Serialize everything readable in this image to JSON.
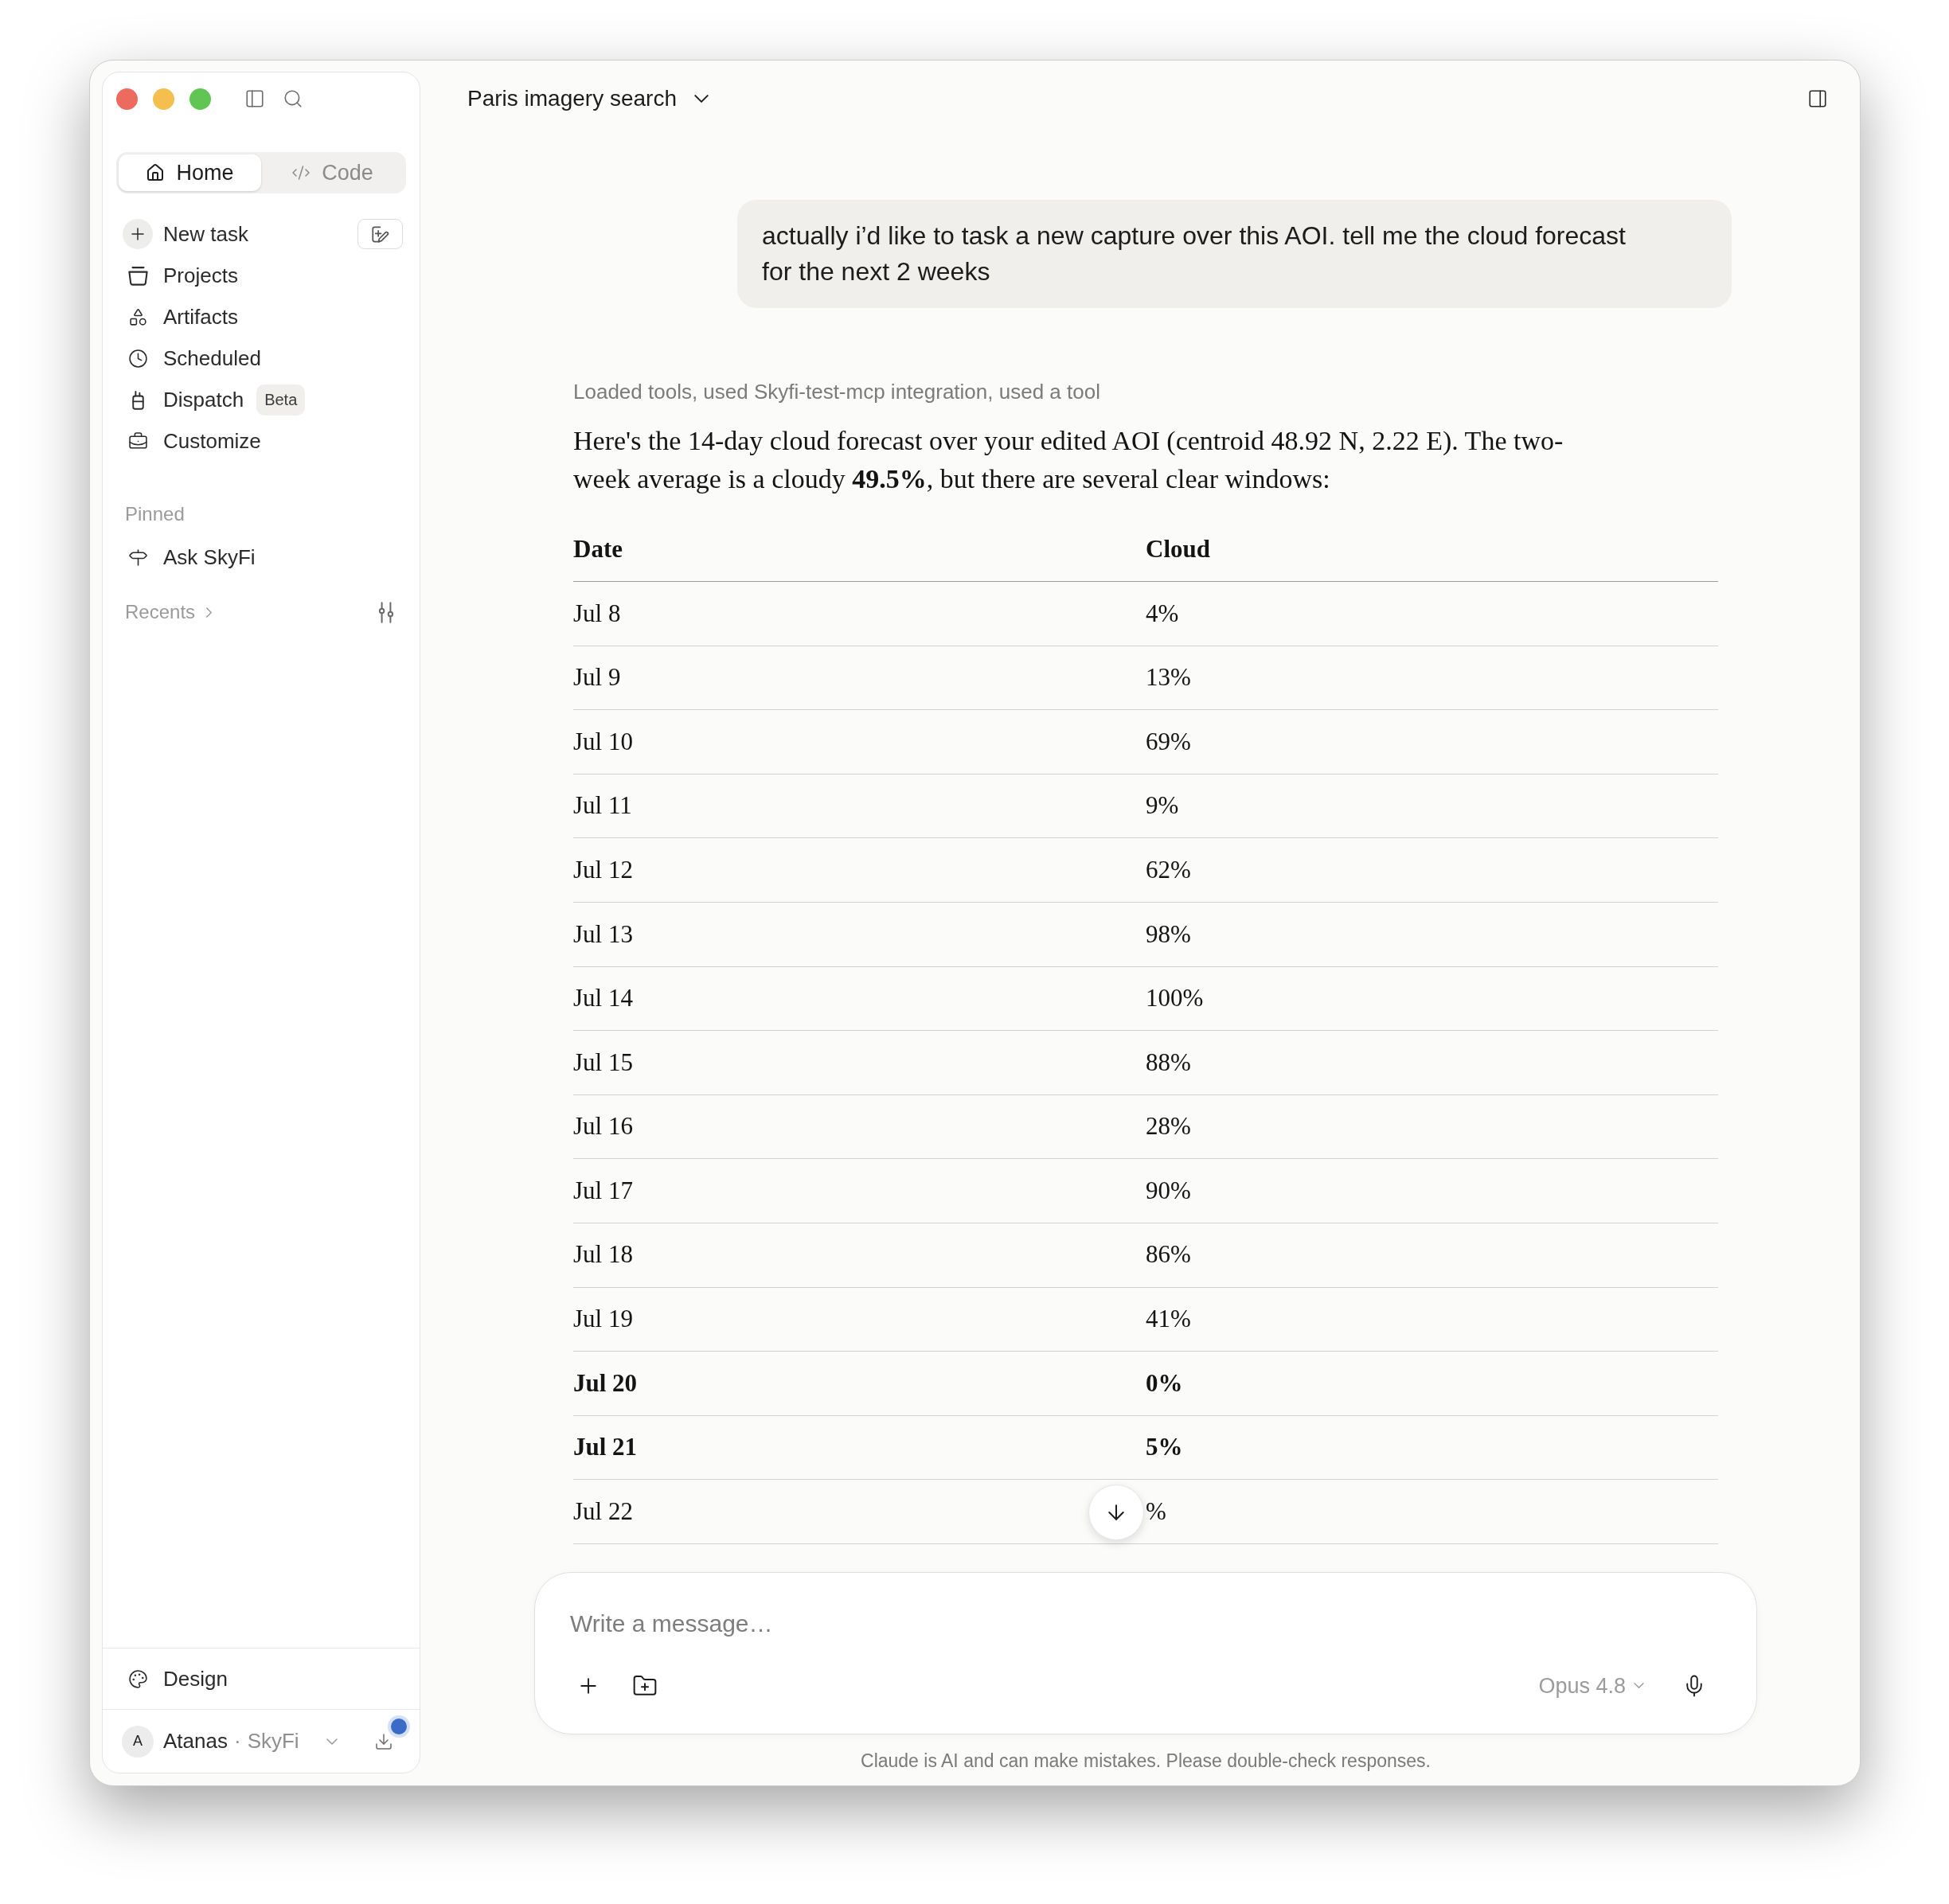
{
  "window": {
    "title": "Paris imagery search"
  },
  "sidebar": {
    "tabs": [
      {
        "label": "Home",
        "selected": true
      },
      {
        "label": "Code",
        "selected": false
      }
    ],
    "nav": [
      {
        "label": "New task",
        "kind": "action"
      },
      {
        "label": "Projects",
        "kind": "link"
      },
      {
        "label": "Artifacts",
        "kind": "link"
      },
      {
        "label": "Scheduled",
        "kind": "link"
      },
      {
        "label": "Dispatch",
        "kind": "link",
        "badge": "Beta"
      },
      {
        "label": "Customize",
        "kind": "link"
      }
    ],
    "pinned": {
      "heading": "Pinned",
      "items": [
        {
          "label": "Ask SkyFi"
        }
      ]
    },
    "recents": {
      "heading": "Recents"
    },
    "footer": [
      {
        "label": "Design"
      }
    ],
    "account": {
      "initial": "A",
      "name": "Atanas",
      "separator": "·",
      "org": "SkyFi",
      "update_badge": true
    }
  },
  "chat": {
    "user_message": "actually i’d like to task a new capture over this AOI. tell me the cloud forecast for the next 2 weeks",
    "tool_summary": "Loaded tools, used Skyfi-test-mcp integration, used a tool",
    "response": "Here's the 14-day cloud forecast over your edited AOI (centroid 48.92 N, 2.22 E). The two-week average is a cloudy **49.5%**, but there are several clear windows:",
    "table": {
      "columns": [
        "Date",
        "Cloud"
      ],
      "rows": [
        {
          "date": "Jul 8",
          "cloud": "4%",
          "bold": false
        },
        {
          "date": "Jul 9",
          "cloud": "13%",
          "bold": false
        },
        {
          "date": "Jul 10",
          "cloud": "69%",
          "bold": false
        },
        {
          "date": "Jul 11",
          "cloud": "9%",
          "bold": false
        },
        {
          "date": "Jul 12",
          "cloud": "62%",
          "bold": false
        },
        {
          "date": "Jul 13",
          "cloud": "98%",
          "bold": false
        },
        {
          "date": "Jul 14",
          "cloud": "100%",
          "bold": false
        },
        {
          "date": "Jul 15",
          "cloud": "88%",
          "bold": false
        },
        {
          "date": "Jul 16",
          "cloud": "28%",
          "bold": false
        },
        {
          "date": "Jul 17",
          "cloud": "90%",
          "bold": false
        },
        {
          "date": "Jul 18",
          "cloud": "86%",
          "bold": false
        },
        {
          "date": "Jul 19",
          "cloud": "41%",
          "bold": false
        },
        {
          "date": "Jul 20",
          "cloud": "0%",
          "bold": true
        },
        {
          "date": "Jul 21",
          "cloud": "5%",
          "bold": true
        },
        {
          "date": "Jul 22",
          "cloud": "%",
          "bold": false
        }
      ]
    }
  },
  "composer": {
    "placeholder": "Write a message…",
    "model": "Opus 4.8"
  },
  "disclaimer": "Claude is AI and can make mistakes. Please double-check responses."
}
